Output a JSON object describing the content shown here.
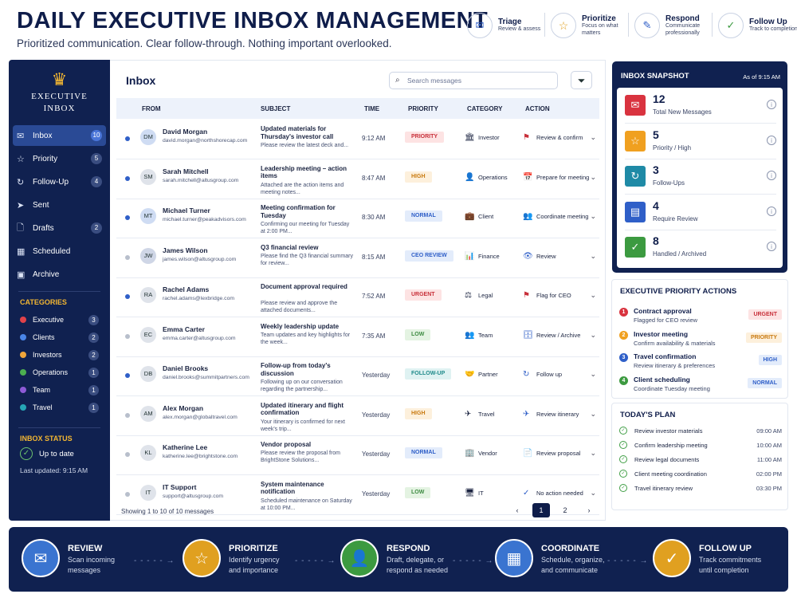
{
  "header": {
    "title": "DAILY EXECUTIVE INBOX MANAGEMENT",
    "subtitle": "Prioritized communication. Clear follow-through. Nothing important overlooked.",
    "steps": [
      {
        "title": "Triage",
        "desc": "Review & assess",
        "icon": "inbox-icon"
      },
      {
        "title": "Prioritize",
        "desc": "Focus on what matters",
        "icon": "star-icon"
      },
      {
        "title": "Respond",
        "desc": "Communicate professionally",
        "icon": "pencil-icon"
      },
      {
        "title": "Follow Up",
        "desc": "Track to completion",
        "icon": "check-icon"
      }
    ]
  },
  "sidebar": {
    "logo_line1": "EXECUTIVE",
    "logo_line2": "INBOX",
    "nav": [
      {
        "label": "Inbox",
        "count": "10"
      },
      {
        "label": "Priority",
        "count": "5"
      },
      {
        "label": "Follow-Up",
        "count": "4"
      },
      {
        "label": "Sent",
        "count": ""
      },
      {
        "label": "Drafts",
        "count": "2"
      },
      {
        "label": "Scheduled",
        "count": ""
      },
      {
        "label": "Archive",
        "count": ""
      }
    ],
    "categories_label": "CATEGORIES",
    "categories": [
      {
        "label": "Executive",
        "count": "3",
        "color": "#e0424a"
      },
      {
        "label": "Clients",
        "count": "2",
        "color": "#4a86e8"
      },
      {
        "label": "Investors",
        "count": "2",
        "color": "#f0a63a"
      },
      {
        "label": "Operations",
        "count": "1",
        "color": "#4caf50"
      },
      {
        "label": "Team",
        "count": "1",
        "color": "#8e5bd6"
      },
      {
        "label": "Travel",
        "count": "1",
        "color": "#26a6b5"
      }
    ],
    "status_label": "INBOX STATUS",
    "status_text": "Up to date",
    "last_updated": "Last updated: 9:15 AM"
  },
  "inbox": {
    "title": "Inbox",
    "search_placeholder": "Search messages",
    "columns": {
      "from": "FROM",
      "subject": "SUBJECT",
      "time": "TIME",
      "priority": "PRIORITY",
      "category": "CATEGORY",
      "action": "ACTION"
    },
    "rows": [
      {
        "initials": "DM",
        "name": "David Morgan",
        "email": "david.morgan@northshorecap.com",
        "subject": "Updated materials for Thursday's investor call",
        "preview": "Please review the latest deck and...",
        "time": "9:12 AM",
        "priority": "PRIORITY",
        "category": "Investor",
        "cat_icon": "🏛",
        "action": "Review & confirm",
        "act_icon": "⚑"
      },
      {
        "initials": "SM",
        "name": "Sarah Mitchell",
        "email": "sarah.mitchell@altusgroup.com",
        "subject": "Leadership meeting – action items",
        "preview": "Attached are the action items and meeting notes...",
        "time": "8:47 AM",
        "priority": "HIGH",
        "category": "Operations",
        "cat_icon": "👤",
        "action": "Prepare for meeting",
        "act_icon": "📅"
      },
      {
        "initials": "MT",
        "name": "Michael Turner",
        "email": "michael.turner@peakadvisors.com",
        "subject": "Meeting confirmation for Tuesday",
        "preview": "Confirming our meeting for Tuesday at 2:00 PM...",
        "time": "8:30 AM",
        "priority": "NORMAL",
        "category": "Client",
        "cat_icon": "💼",
        "action": "Coordinate meeting",
        "act_icon": "👥"
      },
      {
        "initials": "JW",
        "name": "James Wilson",
        "email": "james.wilson@altusgroup.com",
        "subject": "Q3 financial review",
        "preview": "Please find the Q3 financial summary for review...",
        "time": "8:15 AM",
        "priority": "CEO REVIEW",
        "category": "Finance",
        "cat_icon": "📊",
        "action": "Review",
        "act_icon": "👁"
      },
      {
        "initials": "RA",
        "name": "Rachel Adams",
        "email": "rachel.adams@lexbridge.com",
        "subject": "Document approval required",
        "preview": "Please review and approve the attached documents...",
        "time": "7:52 AM",
        "priority": "URGENT",
        "category": "Legal",
        "cat_icon": "⚖",
        "action": "Flag for CEO",
        "act_icon": "⚑"
      },
      {
        "initials": "EC",
        "name": "Emma Carter",
        "email": "emma.carter@altusgroup.com",
        "subject": "Weekly leadership update",
        "preview": "Team updates and key highlights for the week...",
        "time": "7:35 AM",
        "priority": "LOW",
        "category": "Team",
        "cat_icon": "👥",
        "action": "Review / Archive",
        "act_icon": "🗄"
      },
      {
        "initials": "DB",
        "name": "Daniel Brooks",
        "email": "daniel.brooks@summitpartners.com",
        "subject": "Follow-up from today's discussion",
        "preview": "Following up on our conversation regarding the partnership...",
        "time": "Yesterday",
        "priority": "FOLLOW-UP",
        "category": "Partner",
        "cat_icon": "🤝",
        "action": "Follow up",
        "act_icon": "↻"
      },
      {
        "initials": "AM",
        "name": "Alex Morgan",
        "email": "alex.morgan@globaltravel.com",
        "subject": "Updated itinerary and flight confirmation",
        "preview": "Your itinerary is confirmed for next week's trip...",
        "time": "Yesterday",
        "priority": "HIGH",
        "category": "Travel",
        "cat_icon": "✈",
        "action": "Review itinerary",
        "act_icon": "✈"
      },
      {
        "initials": "KL",
        "name": "Katherine Lee",
        "email": "katherine.lee@brightstone.com",
        "subject": "Vendor proposal",
        "preview": "Please review the proposal from BrightStone Solutions...",
        "time": "Yesterday",
        "priority": "NORMAL",
        "category": "Vendor",
        "cat_icon": "🏢",
        "action": "Review proposal",
        "act_icon": "📄"
      },
      {
        "initials": "IT",
        "name": "IT Support",
        "email": "support@altusgroup.com",
        "subject": "System maintenance notification",
        "preview": "Scheduled maintenance on Saturday at 10:00 PM...",
        "time": "Yesterday",
        "priority": "LOW",
        "category": "IT",
        "cat_icon": "🖥",
        "action": "No action needed",
        "act_icon": "✓"
      }
    ],
    "showing": "Showing 1 to 10 of 10 messages",
    "pages": [
      "1",
      "2"
    ]
  },
  "snapshot": {
    "title": "INBOX SNAPSHOT",
    "as_of": "As of 9:15 AM",
    "stats": [
      {
        "value": "12",
        "label": "Total New Messages",
        "color": "#d9333f",
        "icon": "mail-icon"
      },
      {
        "value": "5",
        "label": "Priority / High",
        "color": "#f0a020",
        "icon": "star-icon"
      },
      {
        "value": "3",
        "label": "Follow-Ups",
        "color": "#1f8aa6",
        "icon": "refresh-icon"
      },
      {
        "value": "4",
        "label": "Require Review",
        "color": "#2f5fc8",
        "icon": "document-icon"
      },
      {
        "value": "8",
        "label": "Handled / Archived",
        "color": "#3c9a40",
        "icon": "check-icon"
      }
    ]
  },
  "priority_actions": {
    "title": "EXECUTIVE PRIORITY ACTIONS",
    "items": [
      {
        "num": "1",
        "title": "Contract approval",
        "desc": "Flagged for CEO review",
        "badge": "URGENT",
        "color": "#d9333f"
      },
      {
        "num": "2",
        "title": "Investor meeting",
        "desc": "Confirm availability & materials",
        "badge": "PRIORITY",
        "color": "#f0a020"
      },
      {
        "num": "3",
        "title": "Travel confirmation",
        "desc": "Review itinerary & preferences",
        "badge": "HIGH",
        "color": "#2f5fc8"
      },
      {
        "num": "4",
        "title": "Client scheduling",
        "desc": "Coordinate Tuesday meeting",
        "badge": "NORMAL",
        "color": "#3c9a40"
      }
    ]
  },
  "plan": {
    "title": "TODAY'S PLAN",
    "items": [
      {
        "task": "Review investor materials",
        "time": "09:00 AM"
      },
      {
        "task": "Confirm leadership meeting",
        "time": "10:00 AM"
      },
      {
        "task": "Review legal documents",
        "time": "11:00 AM"
      },
      {
        "task": "Client meeting coordination",
        "time": "02:00 PM"
      },
      {
        "task": "Travel itinerary review",
        "time": "03:30 PM"
      }
    ]
  },
  "workflow": [
    {
      "title": "REVIEW",
      "desc1": "Scan incoming",
      "desc2": "messages",
      "color": "#3a74d0",
      "icon": "inbox-icon"
    },
    {
      "title": "PRIORITIZE",
      "desc1": "Identify urgency",
      "desc2": "and importance",
      "color": "#e0a020",
      "icon": "star-icon"
    },
    {
      "title": "RESPOND",
      "desc1": "Draft, delegate, or",
      "desc2": "respond as needed",
      "color": "#3c9a40",
      "icon": "person-icon"
    },
    {
      "title": "COORDINATE",
      "desc1": "Schedule, organize,",
      "desc2": "and communicate",
      "color": "#3a74d0",
      "icon": "calendar-icon"
    },
    {
      "title": "FOLLOW UP",
      "desc1": "Track commitments",
      "desc2": "until completion",
      "color": "#e0a020",
      "icon": "check-icon"
    }
  ]
}
